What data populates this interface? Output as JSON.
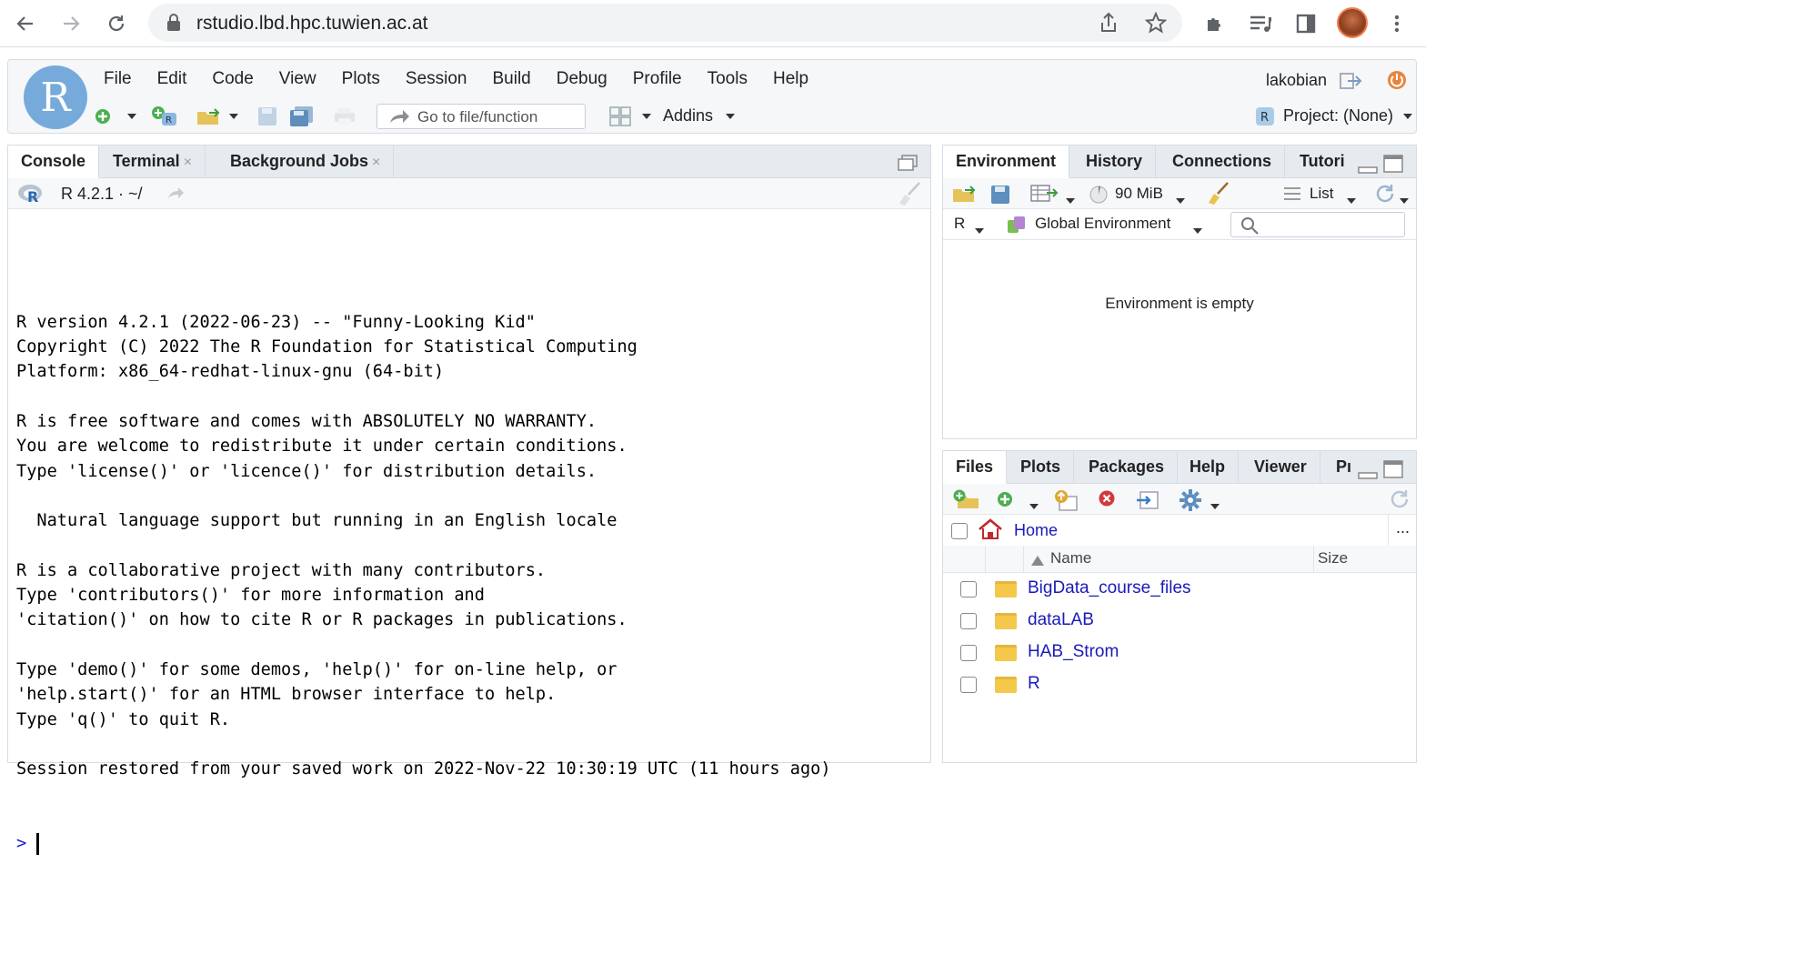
{
  "browser": {
    "url": "rstudio.lbd.hpc.tuwien.ac.at",
    "icons": [
      "back-arrow-icon",
      "forward-arrow-icon",
      "reload-icon",
      "lock-icon",
      "share-icon",
      "star-icon",
      "puzzle-icon",
      "media-queue-icon",
      "sidepanel-icon",
      "avatar",
      "more-vert-icon"
    ]
  },
  "rstudio": {
    "logo": "R",
    "menu": [
      "File",
      "Edit",
      "Code",
      "View",
      "Plots",
      "Session",
      "Build",
      "Debug",
      "Profile",
      "Tools",
      "Help"
    ],
    "user": "lakobian",
    "goto_placeholder": "Go to file/function",
    "addins": "Addins",
    "project": "Project: (None)"
  },
  "console_pane": {
    "tabs": [
      {
        "label": "Console",
        "closable": false
      },
      {
        "label": "Terminal",
        "closable": true
      },
      {
        "label": "Background Jobs",
        "closable": true
      }
    ],
    "close_glyph": "×",
    "version_label": "R 4.2.1 · ~/",
    "output_lines": [
      "",
      "R version 4.2.1 (2022-06-23) -- \"Funny-Looking Kid\"",
      "Copyright (C) 2022 The R Foundation for Statistical Computing",
      "Platform: x86_64-redhat-linux-gnu (64-bit)",
      "",
      "R is free software and comes with ABSOLUTELY NO WARRANTY.",
      "You are welcome to redistribute it under certain conditions.",
      "Type 'license()' or 'licence()' for distribution details.",
      "",
      "  Natural language support but running in an English locale",
      "",
      "R is a collaborative project with many contributors.",
      "Type 'contributors()' for more information and",
      "'citation()' on how to cite R or R packages in publications.",
      "",
      "Type 'demo()' for some demos, 'help()' for on-line help, or",
      "'help.start()' for an HTML browser interface to help.",
      "Type 'q()' to quit R.",
      "",
      "Session restored from your saved work on 2022-Nov-22 10:30:19 UTC (11 hours ago)"
    ],
    "prompt": ">"
  },
  "env_pane": {
    "tabs": [
      "Environment",
      "History",
      "Connections",
      "Tutori"
    ],
    "memory": "90 MiB",
    "view_mode": "List",
    "language": "R",
    "scope": "Global Environment",
    "empty_message": "Environment is empty"
  },
  "files_pane": {
    "tabs": [
      "Files",
      "Plots",
      "Packages",
      "Help",
      "Viewer",
      "Pı"
    ],
    "breadcrumb": "Home",
    "more": "...",
    "columns": {
      "name": "Name",
      "size": "Size"
    },
    "items": [
      "BigData_course_files",
      "dataLAB",
      "HAB_Strom",
      "R"
    ]
  },
  "colors": {
    "accent": "#75aadb",
    "link": "#1a1ab8",
    "folder": "#f4c84a"
  }
}
